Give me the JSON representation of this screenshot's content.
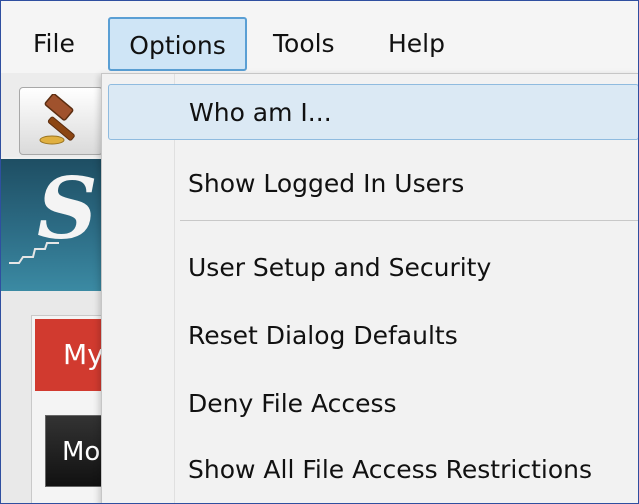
{
  "menubar": {
    "items": [
      {
        "label": "File"
      },
      {
        "label": "Options"
      },
      {
        "label": "Tools"
      },
      {
        "label": "Help"
      }
    ]
  },
  "background": {
    "banner_letters": "S",
    "red_tab_label": "My",
    "dark_header_label": "Mo"
  },
  "options_menu": {
    "items": [
      {
        "label": "Who am I..."
      },
      {
        "label": "Show Logged In Users"
      },
      {
        "label": "User Setup and Security"
      },
      {
        "label": "Reset Dialog Defaults"
      },
      {
        "label": "Deny File Access"
      },
      {
        "label": "Show All File Access Restrictions"
      }
    ]
  },
  "colors": {
    "menu_highlight": "#cfe5f6",
    "menu_highlight_border": "#5a9fd4",
    "banner": "#2d6d86",
    "red_tab": "#d13a2f"
  }
}
